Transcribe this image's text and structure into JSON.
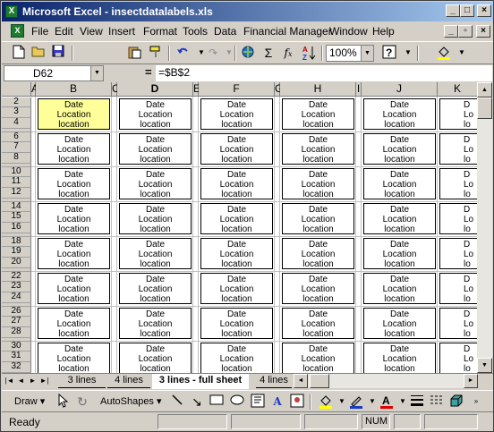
{
  "titlebar": {
    "app_icon": "X",
    "title": "Microsoft Excel - insectdatalabels.xls",
    "min": "_",
    "max": "□",
    "close": "×"
  },
  "menubar": {
    "items": [
      "File",
      "Edit",
      "View",
      "Insert",
      "Format",
      "Tools",
      "Data",
      "Financial Manager",
      "Window",
      "Help"
    ],
    "mdi_min": "_",
    "mdi_restore": "▫",
    "mdi_close": "×"
  },
  "toolbar": {
    "zoom": "100%",
    "icons": [
      "new-document-icon",
      "open-folder-icon",
      "save-icon",
      "paste-icon",
      "format-painter-icon",
      "undo-icon",
      "redo-icon",
      "insert-hyperlink-icon",
      "autosum-icon",
      "function-icon",
      "sort-icon",
      "help-icon",
      "fill-color-icon"
    ]
  },
  "formulabar": {
    "name_box": "D62",
    "equals": "=",
    "formula": "=$B$2"
  },
  "grid": {
    "columns": [
      {
        "letter": "A",
        "selected": false
      },
      {
        "letter": "B",
        "selected": false
      },
      {
        "letter": "C",
        "selected": false
      },
      {
        "letter": "D",
        "selected": true
      },
      {
        "letter": "E",
        "selected": false
      },
      {
        "letter": "F",
        "selected": false
      },
      {
        "letter": "G",
        "selected": false
      },
      {
        "letter": "H",
        "selected": false
      },
      {
        "letter": "I",
        "selected": false
      },
      {
        "letter": "J",
        "selected": false
      },
      {
        "letter": "K",
        "selected": false
      }
    ],
    "row_groups": [
      [
        "2",
        "3",
        "4"
      ],
      [
        "6",
        "7",
        "8"
      ],
      [
        "10",
        "11",
        "12"
      ],
      [
        "14",
        "15",
        "16"
      ],
      [
        "18",
        "19",
        "20"
      ],
      [
        "22",
        "23",
        "24"
      ],
      [
        "26",
        "27",
        "28"
      ],
      [
        "30",
        "31",
        "32"
      ]
    ],
    "label_lines": [
      "Date",
      "Location",
      "location"
    ],
    "label_lines_partial": [
      "D",
      "Lo",
      "lo"
    ]
  },
  "sheet_tabs": {
    "nav": [
      "|◄",
      "◄",
      "►",
      "►|"
    ],
    "tabs": [
      "3 lines",
      "4 lines",
      "3 lines - full sheet",
      "4 lines"
    ],
    "active_index": 2
  },
  "drawing_toolbar": {
    "draw": "Draw ▾",
    "autoshapes": "AutoShapes ▾"
  },
  "statusbar": {
    "status": "Ready",
    "num": "NUM"
  },
  "colors": {
    "title_start": "#0a246a",
    "title_end": "#a6caf0",
    "selected_fill": "#ffff99",
    "chrome": "#d4d0c8"
  }
}
